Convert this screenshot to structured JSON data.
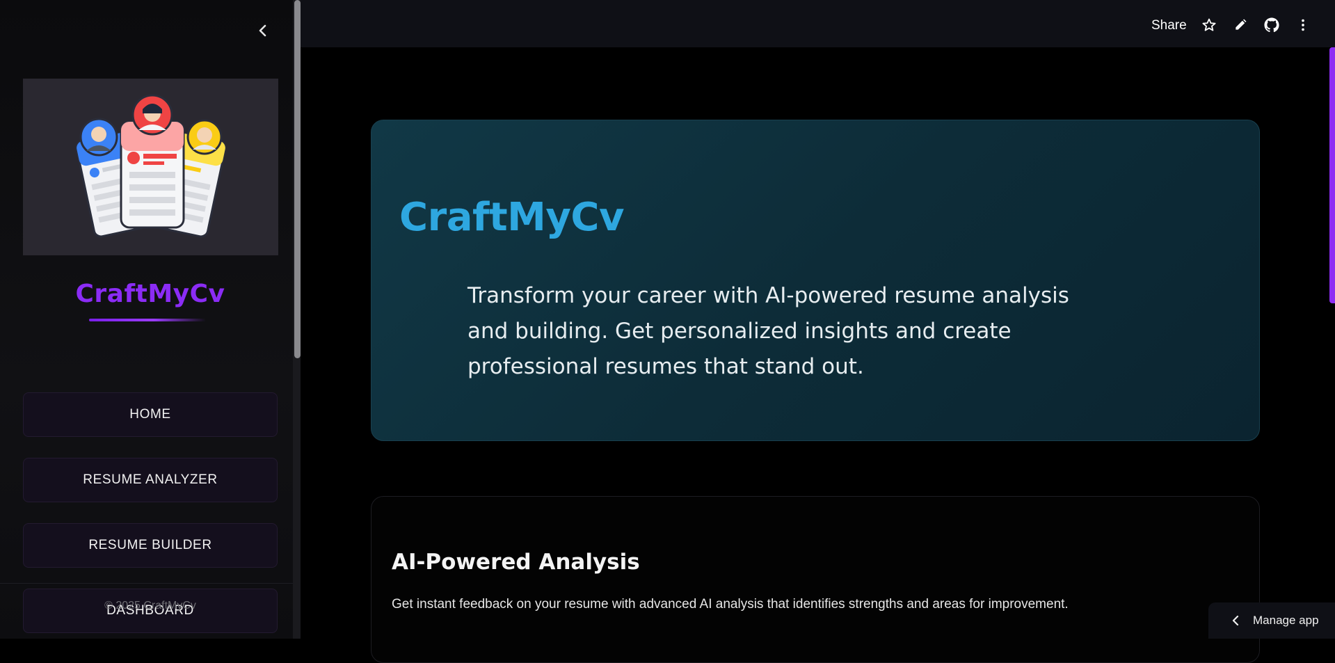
{
  "sidebar": {
    "collapse_icon": "chevron-left-icon",
    "logo_icon": "resume-cards-illustration",
    "brand": "CraftMyCv",
    "nav": [
      {
        "label": "HOME"
      },
      {
        "label": "RESUME ANALYZER"
      },
      {
        "label": "RESUME BUILDER"
      },
      {
        "label": "DASHBOARD"
      }
    ],
    "copyright": "© 2025 CraftMyCv"
  },
  "header": {
    "share_label": "Share",
    "icons": [
      "star-icon",
      "pencil-icon",
      "github-icon",
      "more-vertical-icon"
    ]
  },
  "hero": {
    "title": "CraftMyCv",
    "description": "Transform your career with AI-powered resume analysis and building. Get personalized insights and create professional resumes that stand out."
  },
  "feature": {
    "title": "AI-Powered Analysis",
    "description": "Get instant feedback on your resume with advanced AI analysis that identifies strengths and areas for improvement."
  },
  "manage_app": {
    "label": "Manage app",
    "icon": "chevron-left-icon"
  },
  "colors": {
    "brand_purple": "#8b2cf5",
    "hero_title_blue": "#2ea7e0",
    "hero_bg": "#0d2c38",
    "accent_bar": "#8e2cf3"
  }
}
